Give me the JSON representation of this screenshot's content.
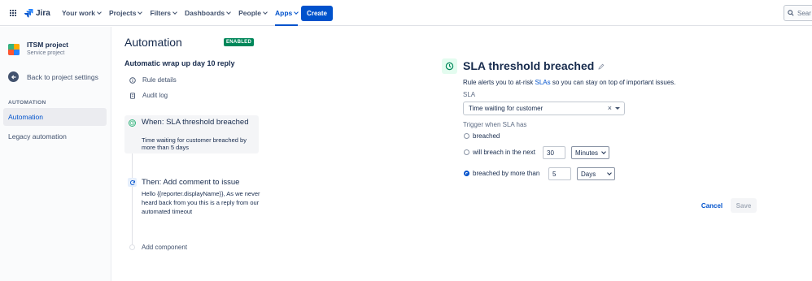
{
  "topnav": {
    "product_name": "Jira",
    "items": [
      {
        "label": "Your work"
      },
      {
        "label": "Projects"
      },
      {
        "label": "Filters"
      },
      {
        "label": "Dashboards"
      },
      {
        "label": "People"
      },
      {
        "label": "Apps"
      }
    ],
    "active_item": "Apps",
    "create_label": "Create",
    "search_placeholder": "Sear"
  },
  "sidebar": {
    "project_name": "ITSM project",
    "project_type": "Service project",
    "back_label": "Back to project settings",
    "section_heading": "AUTOMATION",
    "items": [
      {
        "label": "Automation"
      },
      {
        "label": "Legacy automation"
      }
    ]
  },
  "automation": {
    "title": "Automation",
    "status_badge": "ENABLED",
    "rule_name": "Automatic wrap up day 10 reply",
    "links": [
      {
        "label": "Rule details"
      },
      {
        "label": "Audit log"
      }
    ],
    "trigger": {
      "title": "When: SLA threshold breached",
      "description": "Time waiting for customer breached by more than 5 days"
    },
    "action": {
      "title": "Then: Add comment to issue",
      "description": "Hello {{reporter.displayName}}, As we never heard back from you this is a reply from our automated timeout"
    },
    "add_component_label": "Add component"
  },
  "config": {
    "title": "SLA threshold breached",
    "description_prefix": "Rule alerts you to at-risk",
    "description_link": "SLAs",
    "description_suffix": "so you can stay on top of important issues.",
    "sla_label": "SLA",
    "sla_value": "Time waiting for customer",
    "trigger_label": "Trigger when SLA has",
    "options": [
      {
        "label": "breached",
        "checked": false
      },
      {
        "label": "will breach in the next",
        "checked": false,
        "number": "30",
        "unit": "Minutes"
      },
      {
        "label": "breached by more than",
        "checked": true,
        "number": "5",
        "unit": "Days"
      }
    ],
    "cancel_label": "Cancel",
    "save_label": "Save"
  },
  "colors": {
    "brand_blue": "#0052cc",
    "enabled_green": "#00875a",
    "text_dark": "#172b4d"
  }
}
